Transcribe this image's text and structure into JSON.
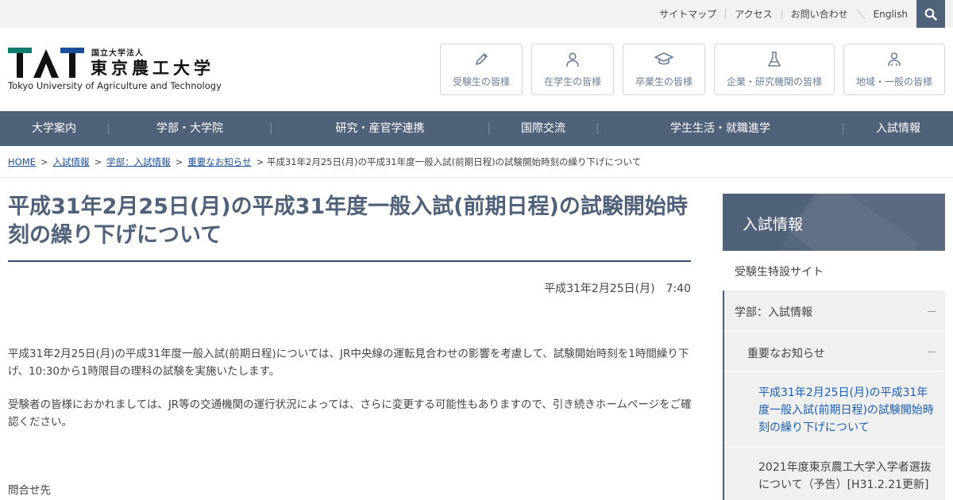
{
  "utility": {
    "links": [
      "サイトマップ",
      "アクセス",
      "お問い合わせ",
      "English"
    ]
  },
  "logo": {
    "corp": "国立大学法人",
    "jname": "東京農工大学",
    "ename": "Tokyo University of Agriculture and Technology",
    "colors": {
      "teal": "#0a7c6e",
      "blue": "#1b4f9c",
      "black": "#111111"
    }
  },
  "audience": [
    {
      "label": "受験生の皆様",
      "icon": "pencil-icon"
    },
    {
      "label": "在学生の皆様",
      "icon": "person-icon"
    },
    {
      "label": "卒業生の皆様",
      "icon": "graduation-cap-icon"
    },
    {
      "label": "企業・研究機関の皆様",
      "icon": "flask-icon"
    },
    {
      "label": "地域・一般の皆様",
      "icon": "people-icon"
    }
  ],
  "nav": [
    "大学案内",
    "学部・大学院",
    "研究・産官学連携",
    "国際交流",
    "学生生活・就職進学",
    "入試情報"
  ],
  "breadcrumb": {
    "links": [
      "HOME",
      "入試情報",
      "学部：入試情報",
      "重要なお知らせ"
    ],
    "current": "平成31年2月25日(月)の平成31年度一般入試(前期日程)の試験開始時刻の繰り下げについて"
  },
  "article": {
    "title": "平成31年2月25日(月)の平成31年度一般入試(前期日程)の試験開始時刻の繰り下げについて",
    "date": "平成31年2月25日(月)　7:40",
    "paragraphs": [
      "平成31年2月25日(月)の平成31年度一般入試(前期日程)については、JR中央線の運転見合わせの影響を考慮して、試験開始時刻を1時間繰り下げ、10:30から1時限目の理科の試験を実施いたします。",
      "受験者の皆様におかれましては、JR等の交通機関の運行状況によっては、さらに変更する可能性もありますので、引き続きホームページをご確認ください。"
    ],
    "contact_label": "問合せ先"
  },
  "sidebar": {
    "title": "入試情報",
    "items": [
      {
        "label": "受験生特設サイト"
      },
      {
        "label": "学部：入試情報"
      },
      {
        "label": "重要なお知らせ"
      },
      {
        "label": "平成31年2月25日(月)の平成31年度一般入試(前期日程)の試験開始時刻の繰り下げについて"
      },
      {
        "label": "2021年度東京農工大学入学者選抜について（予告）[H31.2.21更新]"
      }
    ]
  },
  "colors": {
    "nav_bg": "#50627a",
    "link": "#1a4f9c",
    "active_link": "#1a5fb4",
    "sidebar_expanded_bg": "#f0f0f0"
  }
}
